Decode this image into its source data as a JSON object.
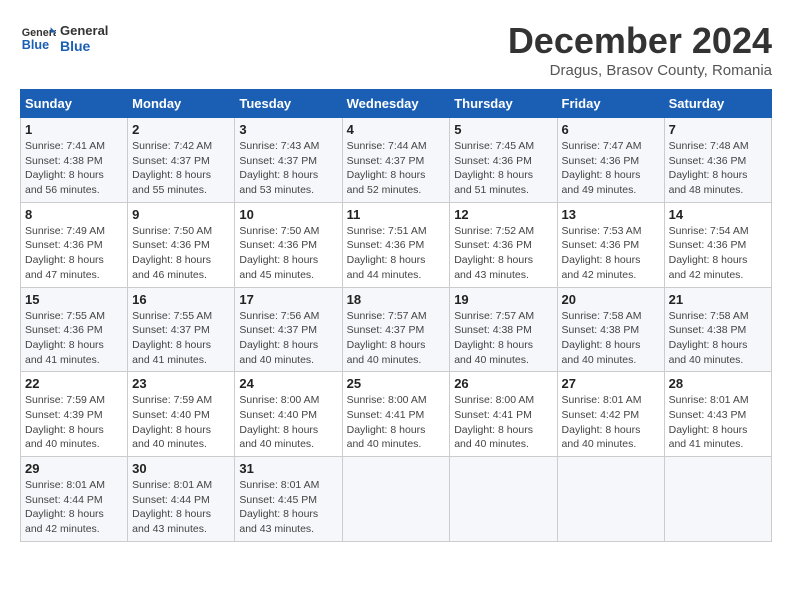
{
  "header": {
    "logo_general": "General",
    "logo_blue": "Blue",
    "title": "December 2024",
    "subtitle": "Dragus, Brasov County, Romania"
  },
  "calendar": {
    "days_of_week": [
      "Sunday",
      "Monday",
      "Tuesday",
      "Wednesday",
      "Thursday",
      "Friday",
      "Saturday"
    ],
    "weeks": [
      [
        {
          "day": "",
          "sunrise": "",
          "sunset": "",
          "daylight": ""
        },
        {
          "day": "",
          "sunrise": "",
          "sunset": "",
          "daylight": ""
        },
        {
          "day": "3",
          "sunrise": "Sunrise: 7:43 AM",
          "sunset": "Sunset: 4:37 PM",
          "daylight": "Daylight: 8 hours and 53 minutes."
        },
        {
          "day": "4",
          "sunrise": "Sunrise: 7:44 AM",
          "sunset": "Sunset: 4:37 PM",
          "daylight": "Daylight: 8 hours and 52 minutes."
        },
        {
          "day": "5",
          "sunrise": "Sunrise: 7:45 AM",
          "sunset": "Sunset: 4:36 PM",
          "daylight": "Daylight: 8 hours and 51 minutes."
        },
        {
          "day": "6",
          "sunrise": "Sunrise: 7:47 AM",
          "sunset": "Sunset: 4:36 PM",
          "daylight": "Daylight: 8 hours and 49 minutes."
        },
        {
          "day": "7",
          "sunrise": "Sunrise: 7:48 AM",
          "sunset": "Sunset: 4:36 PM",
          "daylight": "Daylight: 8 hours and 48 minutes."
        }
      ],
      [
        {
          "day": "1",
          "sunrise": "Sunrise: 7:41 AM",
          "sunset": "Sunset: 4:38 PM",
          "daylight": "Daylight: 8 hours and 56 minutes."
        },
        {
          "day": "2",
          "sunrise": "Sunrise: 7:42 AM",
          "sunset": "Sunset: 4:37 PM",
          "daylight": "Daylight: 8 hours and 55 minutes."
        },
        {
          "day": "",
          "sunrise": "",
          "sunset": "",
          "daylight": ""
        },
        {
          "day": "",
          "sunrise": "",
          "sunset": "",
          "daylight": ""
        },
        {
          "day": "",
          "sunrise": "",
          "sunset": "",
          "daylight": ""
        },
        {
          "day": "",
          "sunrise": "",
          "sunset": "",
          "daylight": ""
        },
        {
          "day": "",
          "sunrise": "",
          "sunset": "",
          "daylight": ""
        }
      ],
      [
        {
          "day": "8",
          "sunrise": "Sunrise: 7:49 AM",
          "sunset": "Sunset: 4:36 PM",
          "daylight": "Daylight: 8 hours and 47 minutes."
        },
        {
          "day": "9",
          "sunrise": "Sunrise: 7:50 AM",
          "sunset": "Sunset: 4:36 PM",
          "daylight": "Daylight: 8 hours and 46 minutes."
        },
        {
          "day": "10",
          "sunrise": "Sunrise: 7:50 AM",
          "sunset": "Sunset: 4:36 PM",
          "daylight": "Daylight: 8 hours and 45 minutes."
        },
        {
          "day": "11",
          "sunrise": "Sunrise: 7:51 AM",
          "sunset": "Sunset: 4:36 PM",
          "daylight": "Daylight: 8 hours and 44 minutes."
        },
        {
          "day": "12",
          "sunrise": "Sunrise: 7:52 AM",
          "sunset": "Sunset: 4:36 PM",
          "daylight": "Daylight: 8 hours and 43 minutes."
        },
        {
          "day": "13",
          "sunrise": "Sunrise: 7:53 AM",
          "sunset": "Sunset: 4:36 PM",
          "daylight": "Daylight: 8 hours and 42 minutes."
        },
        {
          "day": "14",
          "sunrise": "Sunrise: 7:54 AM",
          "sunset": "Sunset: 4:36 PM",
          "daylight": "Daylight: 8 hours and 42 minutes."
        }
      ],
      [
        {
          "day": "15",
          "sunrise": "Sunrise: 7:55 AM",
          "sunset": "Sunset: 4:36 PM",
          "daylight": "Daylight: 8 hours and 41 minutes."
        },
        {
          "day": "16",
          "sunrise": "Sunrise: 7:55 AM",
          "sunset": "Sunset: 4:37 PM",
          "daylight": "Daylight: 8 hours and 41 minutes."
        },
        {
          "day": "17",
          "sunrise": "Sunrise: 7:56 AM",
          "sunset": "Sunset: 4:37 PM",
          "daylight": "Daylight: 8 hours and 40 minutes."
        },
        {
          "day": "18",
          "sunrise": "Sunrise: 7:57 AM",
          "sunset": "Sunset: 4:37 PM",
          "daylight": "Daylight: 8 hours and 40 minutes."
        },
        {
          "day": "19",
          "sunrise": "Sunrise: 7:57 AM",
          "sunset": "Sunset: 4:38 PM",
          "daylight": "Daylight: 8 hours and 40 minutes."
        },
        {
          "day": "20",
          "sunrise": "Sunrise: 7:58 AM",
          "sunset": "Sunset: 4:38 PM",
          "daylight": "Daylight: 8 hours and 40 minutes."
        },
        {
          "day": "21",
          "sunrise": "Sunrise: 7:58 AM",
          "sunset": "Sunset: 4:38 PM",
          "daylight": "Daylight: 8 hours and 40 minutes."
        }
      ],
      [
        {
          "day": "22",
          "sunrise": "Sunrise: 7:59 AM",
          "sunset": "Sunset: 4:39 PM",
          "daylight": "Daylight: 8 hours and 40 minutes."
        },
        {
          "day": "23",
          "sunrise": "Sunrise: 7:59 AM",
          "sunset": "Sunset: 4:40 PM",
          "daylight": "Daylight: 8 hours and 40 minutes."
        },
        {
          "day": "24",
          "sunrise": "Sunrise: 8:00 AM",
          "sunset": "Sunset: 4:40 PM",
          "daylight": "Daylight: 8 hours and 40 minutes."
        },
        {
          "day": "25",
          "sunrise": "Sunrise: 8:00 AM",
          "sunset": "Sunset: 4:41 PM",
          "daylight": "Daylight: 8 hours and 40 minutes."
        },
        {
          "day": "26",
          "sunrise": "Sunrise: 8:00 AM",
          "sunset": "Sunset: 4:41 PM",
          "daylight": "Daylight: 8 hours and 40 minutes."
        },
        {
          "day": "27",
          "sunrise": "Sunrise: 8:01 AM",
          "sunset": "Sunset: 4:42 PM",
          "daylight": "Daylight: 8 hours and 40 minutes."
        },
        {
          "day": "28",
          "sunrise": "Sunrise: 8:01 AM",
          "sunset": "Sunset: 4:43 PM",
          "daylight": "Daylight: 8 hours and 41 minutes."
        }
      ],
      [
        {
          "day": "29",
          "sunrise": "Sunrise: 8:01 AM",
          "sunset": "Sunset: 4:44 PM",
          "daylight": "Daylight: 8 hours and 42 minutes."
        },
        {
          "day": "30",
          "sunrise": "Sunrise: 8:01 AM",
          "sunset": "Sunset: 4:44 PM",
          "daylight": "Daylight: 8 hours and 43 minutes."
        },
        {
          "day": "31",
          "sunrise": "Sunrise: 8:01 AM",
          "sunset": "Sunset: 4:45 PM",
          "daylight": "Daylight: 8 hours and 43 minutes."
        },
        {
          "day": "",
          "sunrise": "",
          "sunset": "",
          "daylight": ""
        },
        {
          "day": "",
          "sunrise": "",
          "sunset": "",
          "daylight": ""
        },
        {
          "day": "",
          "sunrise": "",
          "sunset": "",
          "daylight": ""
        },
        {
          "day": "",
          "sunrise": "",
          "sunset": "",
          "daylight": ""
        }
      ]
    ]
  }
}
